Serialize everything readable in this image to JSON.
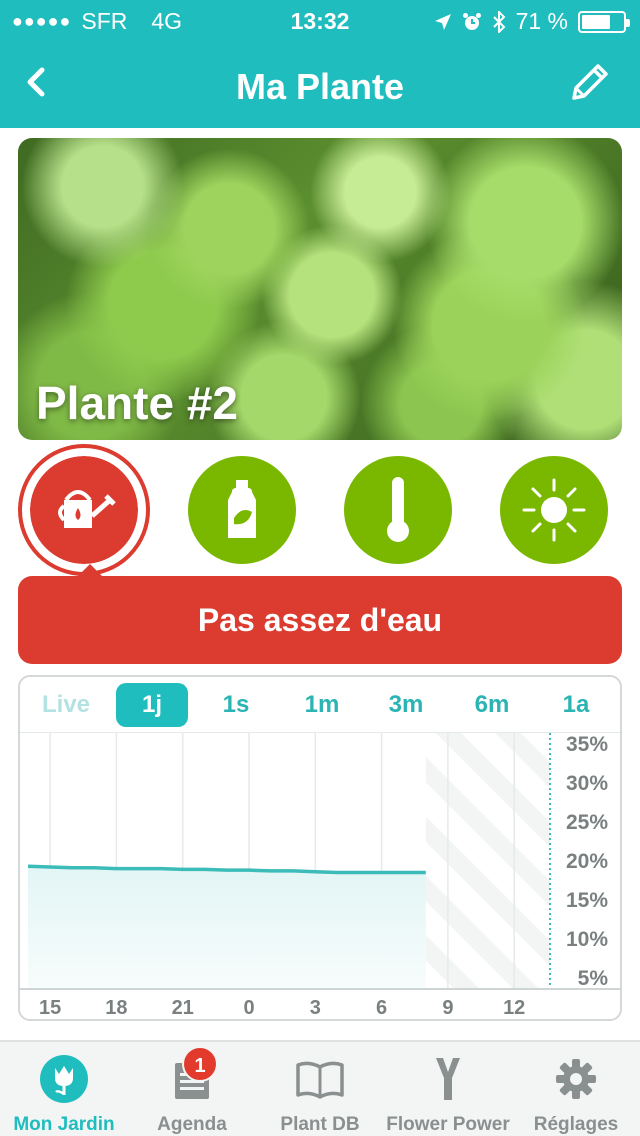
{
  "status_bar": {
    "signal_dots": "●●●●●",
    "carrier": "SFR",
    "network": "4G",
    "time": "13:32",
    "battery": "71 %",
    "battery_level": 0.71
  },
  "nav": {
    "title": "Ma Plante",
    "back_icon": "chevron-left-icon",
    "edit_icon": "pencil-icon"
  },
  "plant": {
    "name": "Plante #2"
  },
  "sensors": [
    {
      "id": "water",
      "icon": "watering-can-icon",
      "active": true,
      "color": "#dc3b2f"
    },
    {
      "id": "fertilizer",
      "icon": "fertilizer-bottle-icon",
      "active": false,
      "color": "#7ab800"
    },
    {
      "id": "temperature",
      "icon": "thermometer-icon",
      "active": false,
      "color": "#7ab800"
    },
    {
      "id": "light",
      "icon": "sun-icon",
      "active": false,
      "color": "#7ab800"
    }
  ],
  "alert": {
    "text": "Pas assez d'eau",
    "color": "#dc3b2f"
  },
  "time_ranges": [
    "Live",
    "1j",
    "1s",
    "1m",
    "3m",
    "6m",
    "1a"
  ],
  "selected_range": "1j",
  "chart_data": {
    "type": "area",
    "x_tick_labels": [
      "15",
      "18",
      "21",
      "0",
      "3",
      "6",
      "9",
      "12"
    ],
    "y_tick_labels": [
      "35%",
      "30%",
      "25%",
      "20%",
      "15%",
      "10%",
      "5%"
    ],
    "ylim": [
      5,
      35
    ],
    "series": [
      {
        "x": [
          "14",
          "15",
          "16",
          "17",
          "18",
          "19",
          "20",
          "21",
          "22",
          "23",
          "0",
          "1",
          "2",
          "3",
          "4",
          "5",
          "6",
          "7",
          "8"
        ],
        "values": [
          19.2,
          19.1,
          19.0,
          19.0,
          18.9,
          18.9,
          18.9,
          18.8,
          18.8,
          18.7,
          18.7,
          18.6,
          18.6,
          18.5,
          18.4,
          18.4,
          18.4,
          18.4,
          18.4
        ]
      }
    ],
    "grid": true,
    "accent": "#3cbcb8"
  },
  "tabbar": {
    "items": [
      {
        "label": "Mon Jardin",
        "icon": "tulip-icon",
        "active": true
      },
      {
        "label": "Agenda",
        "icon": "agenda-icon",
        "active": false,
        "badge": "1"
      },
      {
        "label": "Plant DB",
        "icon": "book-icon",
        "active": false
      },
      {
        "label": "Flower Power",
        "icon": "flower-power-sensor-icon",
        "active": false
      },
      {
        "label": "Réglages",
        "icon": "gear-icon",
        "active": false
      }
    ]
  }
}
